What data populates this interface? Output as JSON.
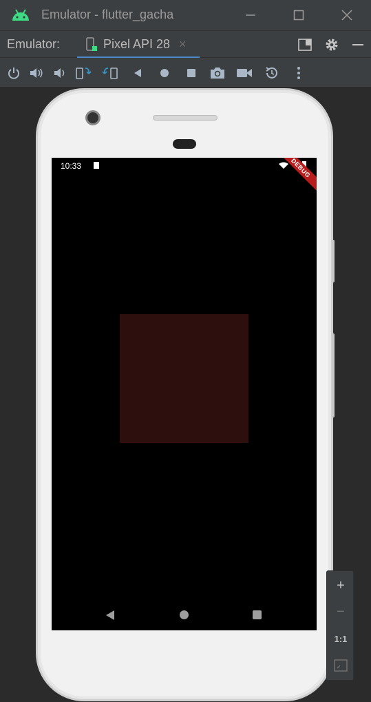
{
  "window": {
    "title": "Emulator - flutter_gacha",
    "app_icon": "android-icon"
  },
  "tabbar": {
    "label": "Emulator:",
    "tab_label": "Pixel API 28",
    "tab_close": "×",
    "tab_icon": "device-icon"
  },
  "toolbar": {
    "buttons": [
      "power",
      "volume-up",
      "volume-down",
      "rotate-left",
      "rotate-right",
      "back",
      "home",
      "overview",
      "screenshot",
      "screen-record",
      "snapshot",
      "more"
    ]
  },
  "phone": {
    "status_time": "10:33",
    "debug_label": "DEBUG",
    "box_color": "#2d0f0d"
  },
  "zoom": {
    "zoom_in": "+",
    "zoom_out": "−",
    "actual_size": "1:1"
  },
  "colors": {
    "accent": "#4a88c7",
    "android_green": "#3ddc84",
    "background": "#2b2b2b"
  }
}
